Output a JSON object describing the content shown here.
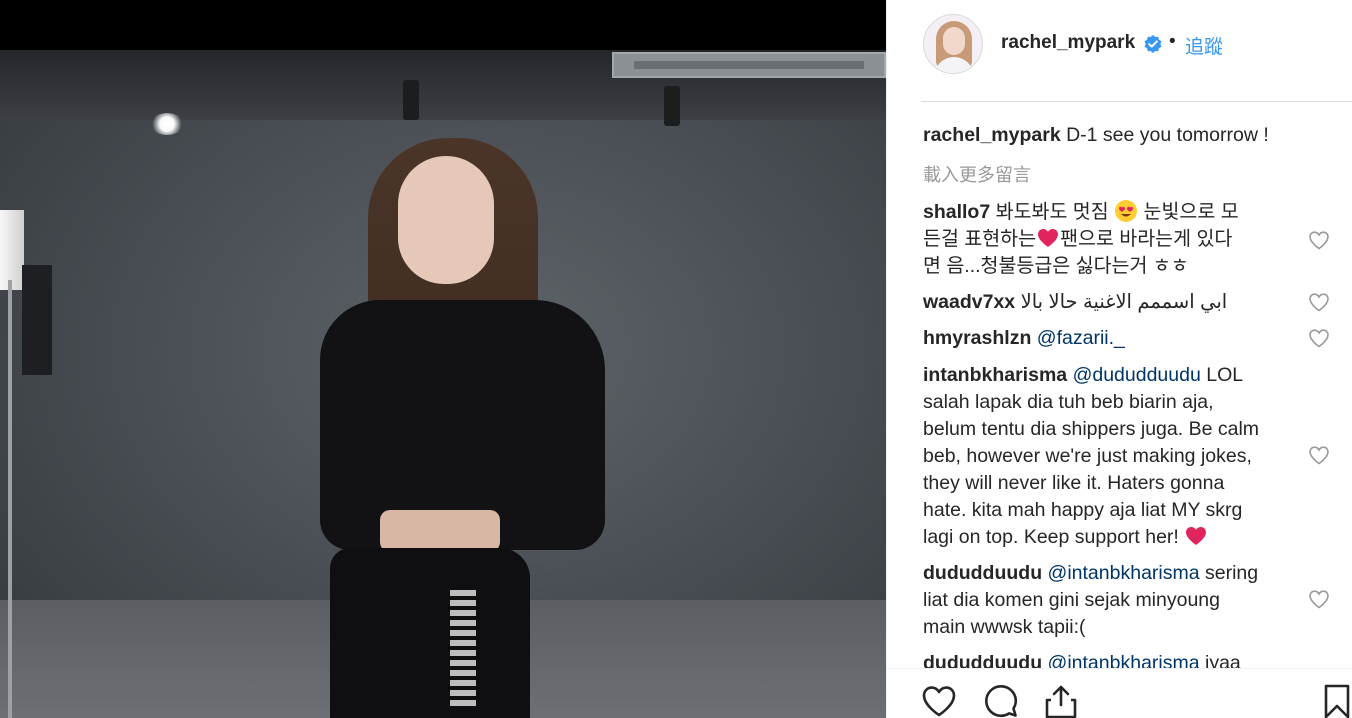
{
  "header": {
    "username": "rachel_mypark",
    "separator": "•",
    "follow_label": "追蹤"
  },
  "caption": {
    "username": "rachel_mypark",
    "text": "D-1 see you tomorrow !"
  },
  "load_more_label": "載入更多留言",
  "comments": [
    {
      "username": "shallo7",
      "lines": [
        "봐도봐도 멋짐",
        "눈빛으로 모",
        "든걸 표현하는",
        "팬으로 바라는게 있다",
        "면 음...청불등급은 싫다는거 ㅎㅎ"
      ]
    },
    {
      "username": "waadv7xx",
      "text": "ابي اسممم الاغنية حالا بالا"
    },
    {
      "username": "hmyrashlzn",
      "mention": "@fazarii._"
    },
    {
      "username": "intanbkharisma",
      "mention": "@dududduudu",
      "lines": [
        "LOL",
        "salah lapak dia tuh beb biarin aja,",
        "belum tentu dia shippers juga. Be calm",
        "beb, however we're just making jokes,",
        "they will never like it. Haters gonna",
        "hate. kita mah happy aja liat MY skrg",
        "lagi on top. Keep support her!"
      ]
    },
    {
      "username": "dududduudu",
      "mention": "@intanbkharisma",
      "lines": [
        "sering",
        "liat dia komen gini sejak minyoung",
        "main wwwsk tapii:("
      ]
    },
    {
      "username": "dududduudu",
      "mention": "@intanbkharisma",
      "lines": [
        "iyaa"
      ]
    }
  ],
  "colors": {
    "follow_blue": "#3897f0",
    "mention_navy": "#003569",
    "heart_red": "#ed4956",
    "muted_gray": "#999999"
  },
  "icons": [
    "verified-badge-icon",
    "heart-eyes-emoji-icon",
    "red-heart-emoji-icon",
    "like-heart-icon",
    "comment-bubble-icon",
    "share-icon",
    "bookmark-icon"
  ]
}
